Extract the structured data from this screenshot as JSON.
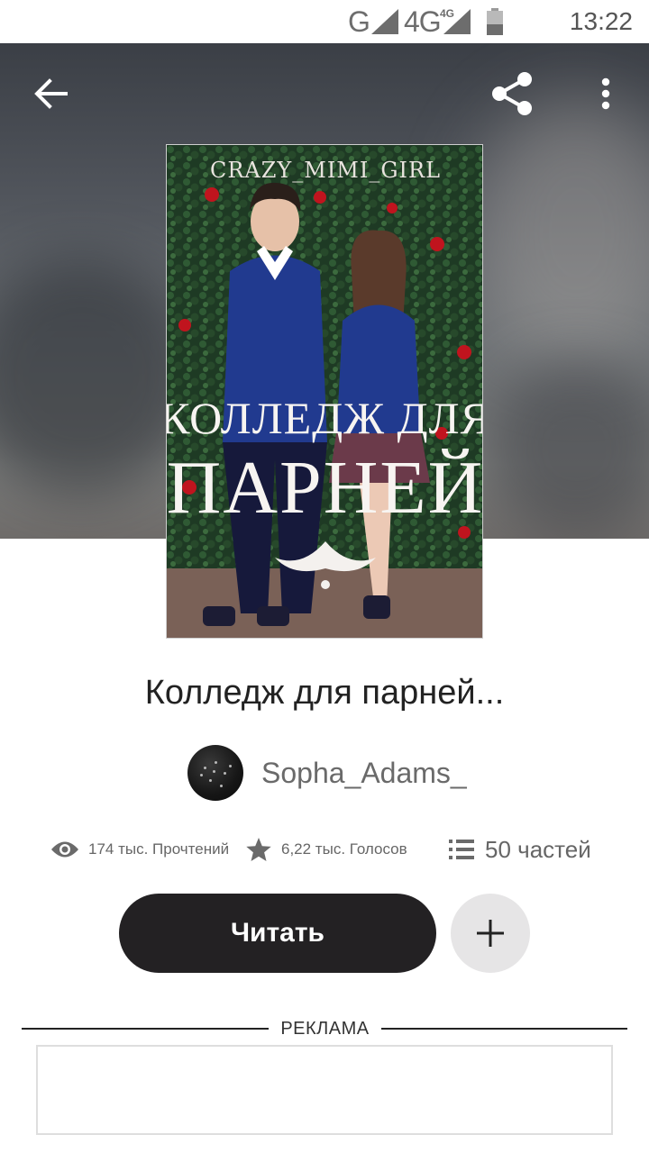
{
  "status_bar": {
    "network_1": "G",
    "network_2": "4G",
    "network_2_small": "4G",
    "time": "13:22"
  },
  "toolbar": {
    "back_icon": "arrow-left-icon",
    "share_icon": "share-icon",
    "more_icon": "more-vertical-icon"
  },
  "cover": {
    "watermark": "CRAZY_MIMI_GIRL",
    "title_line_1": "КОЛЛЕДЖ ДЛЯ",
    "title_line_2": "ПАРНЕЙ"
  },
  "story": {
    "title": "Колледж для парней..."
  },
  "author": {
    "name": "Sopha_Adams_"
  },
  "stats": {
    "reads": "174 тыс. Прочтений",
    "votes": "6,22 тыс. Голосов",
    "parts": "50 частей",
    "reads_icon": "eye-icon",
    "votes_icon": "star-icon",
    "parts_icon": "list-icon"
  },
  "actions": {
    "read_label": "Читать",
    "add_icon": "plus-icon"
  },
  "ad": {
    "label": "РЕКЛАМА"
  },
  "colors": {
    "primary_button": "#232123",
    "secondary_button": "#e6e5e6",
    "text_muted": "#666666"
  }
}
